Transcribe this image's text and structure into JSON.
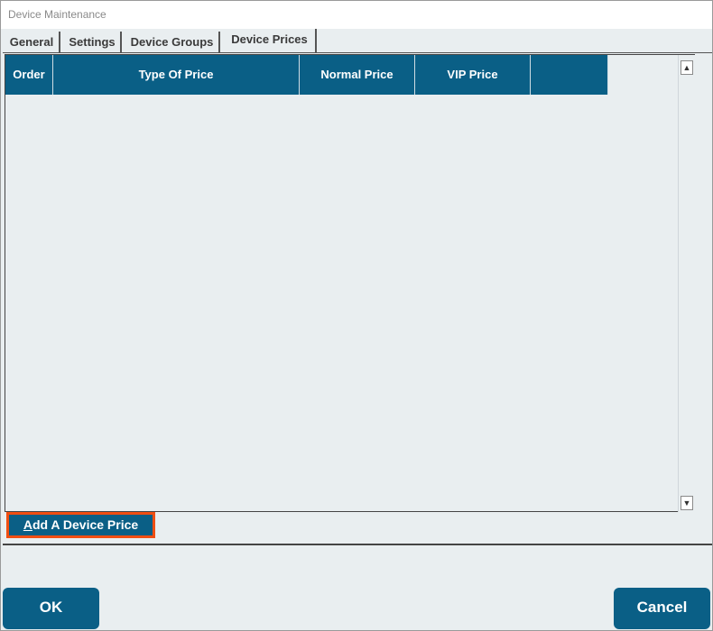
{
  "window": {
    "title": "Device Maintenance"
  },
  "tabs": [
    {
      "label": "General"
    },
    {
      "label": "Settings"
    },
    {
      "label": "Device Groups"
    },
    {
      "label": "Device Prices",
      "active": true
    }
  ],
  "grid": {
    "columns": [
      "Order",
      "Type Of Price",
      "Normal Price",
      "VIP Price",
      ""
    ],
    "rows": []
  },
  "scroll": {
    "up_icon": "arrow-up-icon",
    "down_icon": "arrow-down-icon"
  },
  "actions": {
    "add_prefix": "A",
    "add_rest": "dd A Device Price"
  },
  "footer": {
    "ok_label": "OK",
    "cancel_label": "Cancel"
  },
  "colors": {
    "accent": "#0a5f86",
    "panel_bg": "#e9eef0",
    "highlight_border": "#f04e12"
  }
}
